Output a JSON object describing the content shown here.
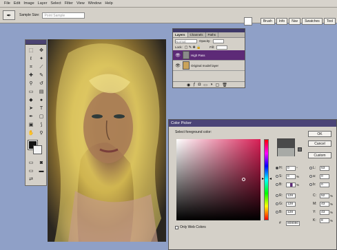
{
  "menu": [
    "File",
    "Edit",
    "Image",
    "Layer",
    "Select",
    "Filter",
    "View",
    "Window",
    "Help"
  ],
  "options": {
    "sample_label": "Sample Size:",
    "sample_value": "Point Sample"
  },
  "palette_well": [
    "Brush",
    "Info",
    "Nav",
    "Swatches",
    "Tool"
  ],
  "layers_panel": {
    "tabs": [
      "Layers",
      "Channels",
      "Paths"
    ],
    "blend_mode": "Normal",
    "opacity_label": "Opacity:",
    "lock_label": "Lock:",
    "fill_label": "Fill:",
    "layers": [
      {
        "name": "High Pass",
        "selected": true
      },
      {
        "name": "Original model layer",
        "selected": false
      }
    ]
  },
  "color_picker": {
    "title": "Color Picker",
    "prompt": "Select foreground color:",
    "buttons": [
      "OK",
      "Cancel",
      "Custom"
    ],
    "hsb": [
      {
        "key": "H:",
        "value": "0",
        "unit": "°"
      },
      {
        "key": "S:",
        "value": "0",
        "unit": "%"
      },
      {
        "key": "B:",
        "value": "",
        "unit": "%"
      }
    ],
    "rgb": [
      {
        "key": "R:",
        "value": "128"
      },
      {
        "key": "G:",
        "value": "128"
      },
      {
        "key": "B:",
        "value": "128"
      }
    ],
    "lab": [
      {
        "key": "L:",
        "value": "53"
      },
      {
        "key": "a:",
        "value": "0"
      },
      {
        "key": "b:",
        "value": "0"
      }
    ],
    "cmyk": [
      {
        "key": "C:",
        "value": "52",
        "unit": "%"
      },
      {
        "key": "M:",
        "value": "43",
        "unit": "%"
      },
      {
        "key": "Y:",
        "value": "43",
        "unit": "%"
      },
      {
        "key": "K:",
        "value": "8",
        "unit": "%"
      }
    ],
    "hex_label": "#",
    "hex": "808080",
    "web_colors_label": "Only Web Colors"
  },
  "colors": {
    "accent": "#5d2a77",
    "desktop": "#8fa0c7",
    "chrome": "#d4d0c8"
  }
}
